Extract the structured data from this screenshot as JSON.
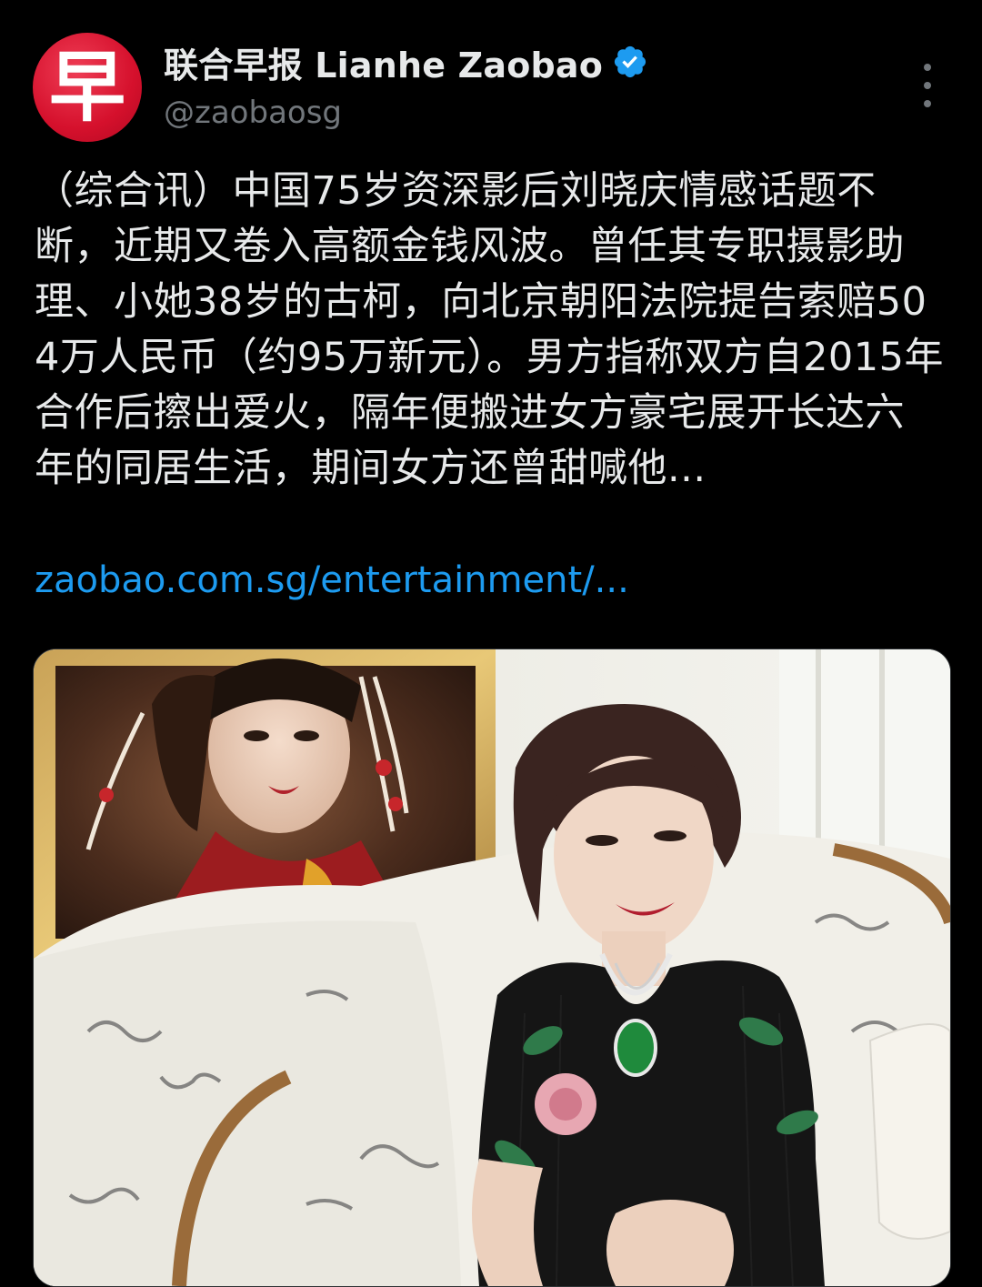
{
  "author": {
    "display_name": "联合早报 Lianhe Zaobao",
    "handle": "@zaobaosg",
    "avatar_glyph": "早",
    "avatar_color": "#d5102c",
    "verified": true,
    "verified_icon": "verified-badge-icon",
    "verified_color": "#1d9bf0"
  },
  "more_icon": "more-vertical-icon",
  "tweet": {
    "text": "（综合讯）中国75岁资深影后刘晓庆情感话题不断，近期又卷入高额金钱风波。曾任其专职摄影助理、小她38岁的古柯，向北京朝阳法院提告索赔504万人民币（约95万新元）。男方指称双方自2015年合作后擦出爱火，隔年便搬进女方豪宅展开长达六年的同居生活，期间女方还曾甜喊他...",
    "link_text": "zaobao.com.sg/entertainment/...",
    "link_color": "#1d9bf0"
  },
  "media": {
    "type": "photo"
  }
}
